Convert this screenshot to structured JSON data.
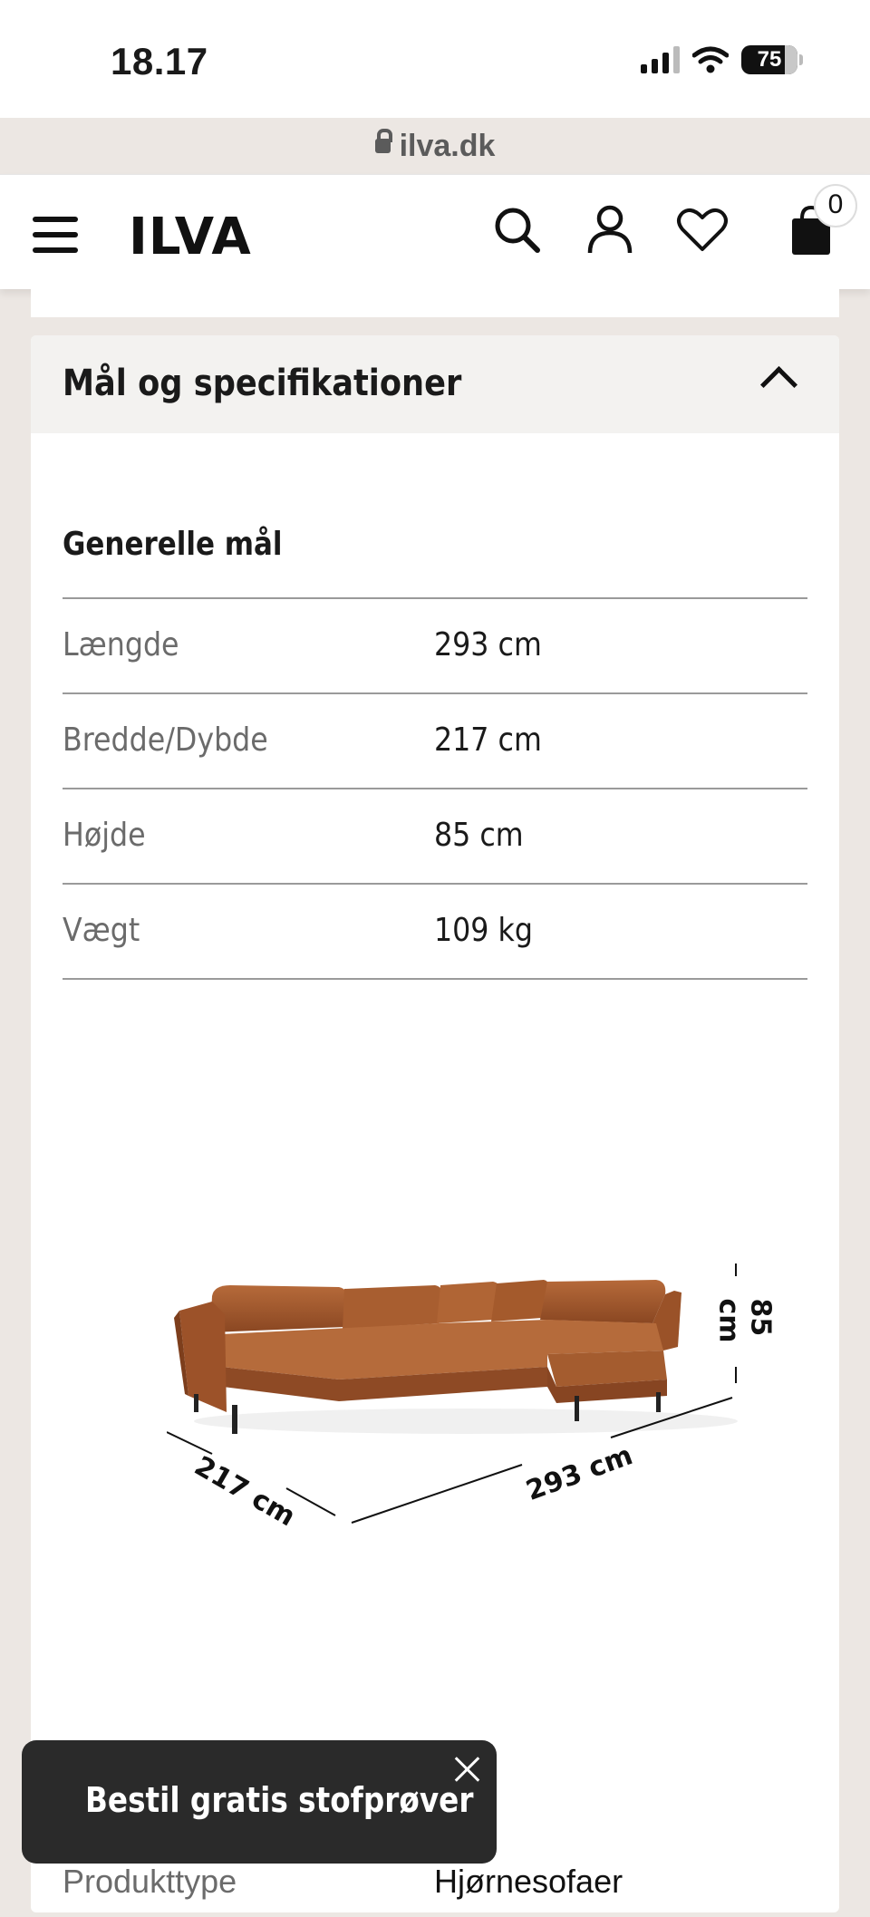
{
  "status_bar": {
    "time": "18.17",
    "battery": "75"
  },
  "browser": {
    "url": "ilva.dk"
  },
  "header": {
    "logo": "ILVA",
    "cart_count": "0"
  },
  "accordion": {
    "title": "Mål og specifikationer"
  },
  "general": {
    "title": "Generelle mål",
    "rows": [
      {
        "label": "Længde",
        "value": "293 cm"
      },
      {
        "label": "Bredde/Dybde",
        "value": "217 cm"
      },
      {
        "label": "Højde",
        "value": "85 cm"
      },
      {
        "label": "Vægt",
        "value": "109 kg"
      }
    ]
  },
  "diagram": {
    "height_label": "85 cm",
    "depth_label": "217 cm",
    "length_label": "293 cm"
  },
  "next_row": {
    "label": "Produkttype",
    "value": "Hjørnesofaer"
  },
  "toast": {
    "label": "Bestil gratis stofprøver"
  }
}
